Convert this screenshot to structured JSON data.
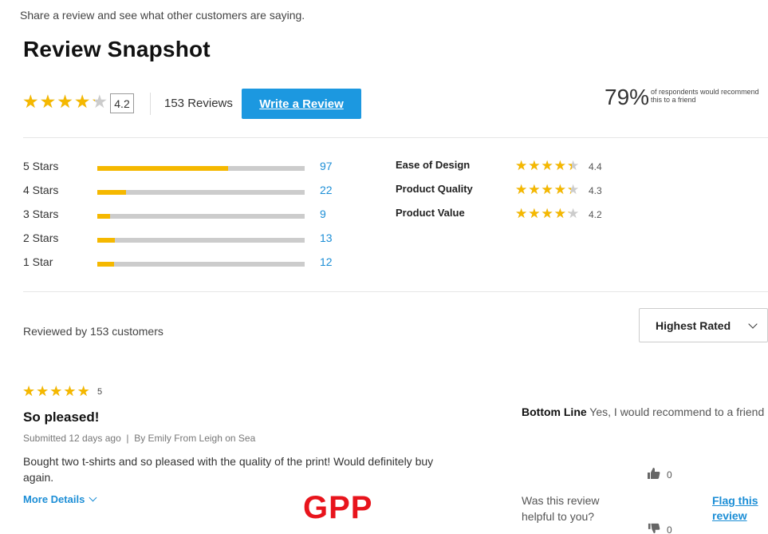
{
  "intro": "Share a review and see what other customers are saying.",
  "title": "Review Snapshot",
  "summary": {
    "average": "4.2",
    "average_value": 4.2,
    "review_count": "153 Reviews",
    "write_review_label": "Write a Review",
    "recommend_percent": "79%",
    "recommend_note": "of respondents would recommend this to a friend"
  },
  "histogram": [
    {
      "label": "5 Stars",
      "count": "97",
      "fraction": 0.63
    },
    {
      "label": "4 Stars",
      "count": "22",
      "fraction": 0.14
    },
    {
      "label": "3 Stars",
      "count": "9",
      "fraction": 0.06
    },
    {
      "label": "2 Stars",
      "count": "13",
      "fraction": 0.085
    },
    {
      "label": "1 Star",
      "count": "12",
      "fraction": 0.08
    }
  ],
  "attributes": [
    {
      "label": "Ease of Design",
      "value": "4.4",
      "rating": 4.4
    },
    {
      "label": "Product Quality",
      "value": "4.3",
      "rating": 4.3
    },
    {
      "label": "Product Value",
      "value": "4.2",
      "rating": 4.2
    }
  ],
  "reviewed_by": "Reviewed by 153 customers",
  "sort": {
    "selected": "Highest Rated"
  },
  "review": {
    "rating": 5,
    "rating_text": "5",
    "title": "So pleased!",
    "meta": "Submitted 12 days ago  |  By Emily From Leigh on Sea",
    "body": "Bought two t-shirts and so pleased with the quality of the print! Would definitely buy again.",
    "more_details": "More Details",
    "bottom_line_label": "Bottom Line",
    "bottom_line_text": "Yes, I would recommend to a friend",
    "helpful_question": "Was this review helpful to you?",
    "helpful_yes": "0",
    "helpful_no": "0",
    "flag_label": "Flag this review"
  },
  "watermark": "GPP",
  "colors": {
    "accent": "#1c98e0",
    "star": "#f5b800",
    "link": "#1c8ed6",
    "watermark": "#e8141c"
  },
  "icons": {
    "thumb_up": "thumbs-up-icon",
    "thumb_down": "thumbs-down-icon",
    "star": "star-icon"
  }
}
